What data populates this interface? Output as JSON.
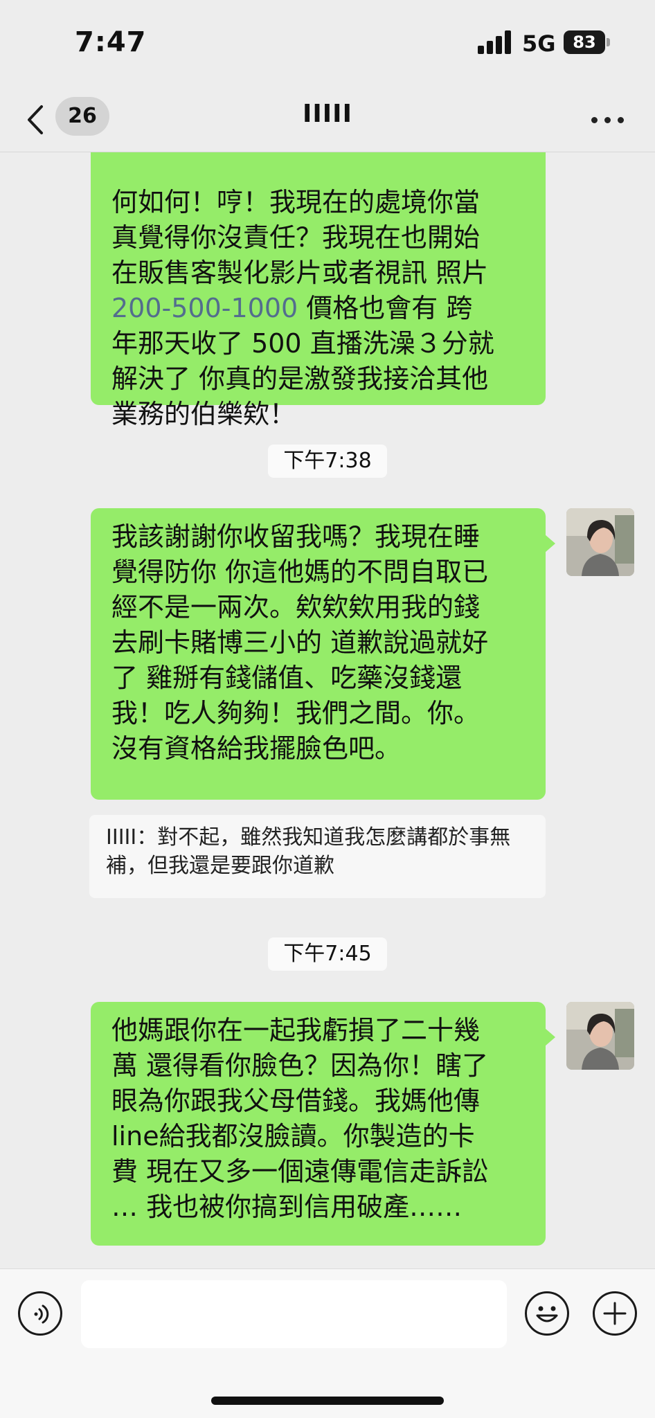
{
  "status_bar": {
    "time": "7:47",
    "network": "5G",
    "battery": "83"
  },
  "nav": {
    "unread_count": "26",
    "title": "IIIII"
  },
  "messages": [
    {
      "lines": [
        "何如何！哼！我現在的處境你當",
        "真覺得你沒責任？我現在也開始",
        "在販售客製化影片或者視訊 照片"
      ],
      "link": "200-500-1000",
      "after_link": " 價格也會有 跨",
      "rest": [
        "年那天收了 500 直播洗澡３分就",
        "解決了 你真的是激發我接洽其他",
        "業務的伯樂欸！"
      ]
    },
    {
      "time": "下午7:38"
    },
    {
      "text": "我該謝謝你收留我嗎？我現在睡\n覺得防你 你這他媽的不問自取已\n經不是一兩次。欸欸欸用我的錢\n去刷卡賭博三小的 道歉說過就好\n了 雞掰有錢儲值、吃藥沒錢還\n我！吃人夠夠！我們之間。你。\n沒有資格給我擺臉色吧。",
      "quote": "IIIII：對不起，雖然我知道我怎麼講都於事無補，但我還是要跟你道歉"
    },
    {
      "time": "下午7:45"
    },
    {
      "text": "他媽跟你在一起我虧損了二十幾\n萬 還得看你臉色？因為你！瞎了\n眼為你跟我父母借錢。我媽他傳\nline給我都沒臉讀。你製造的卡\n費 現在又多一個遠傳電信走訴訟\n… 我也被你搞到信用破產……"
    }
  ],
  "input": {
    "placeholder": ""
  },
  "icons": {
    "back": "chevron-left-icon",
    "more": "more-horizontal-icon",
    "voice": "voice-icon",
    "emoji": "emoji-icon",
    "plus": "plus-icon"
  },
  "colors": {
    "bubble_green": "#95ec69",
    "background": "#ededed",
    "link_blue": "#536d8e"
  }
}
